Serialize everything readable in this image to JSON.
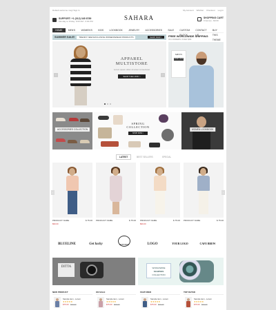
{
  "topbar": {
    "welcome": "Default welcome msg! Sign In",
    "links": [
      "My Account",
      "Wishlist",
      "Checkout",
      "Log In"
    ]
  },
  "header": {
    "support_title": "SUPPORT: +1 (012) 345 6789",
    "support_hours": "Monday to Friday: 9:00 AM - 6:00 PM",
    "logo": "SAHARA",
    "cart_title": "SHOPPING CART",
    "cart_items": "0 item(s) - $0.00"
  },
  "nav": {
    "items": [
      "HOME",
      "MEN'S",
      "WOMEN'S",
      "KIDS",
      "LOOKBOOK",
      "JEWELRY",
      "ACCESSORIES",
      "SALE",
      "CUSTOM BLOCK",
      "CONTACT US",
      "BUY THIS THEME"
    ],
    "active_index": 0
  },
  "promo": {
    "label": "SUMMER SALE!",
    "message": "TRENDY NEW EXCLUSIVE WOMENSWEAR PRODUCTS",
    "button": "SHOP NOW >"
  },
  "hero": {
    "title": "APPAREL MULTISTORE",
    "subtitle": "Lorem ipsum dolor sit amet consectetur",
    "button": "SHOP THE LOOK >",
    "prev": "‹",
    "next": "›",
    "slides": 3,
    "active_slide": 1
  },
  "shipping": {
    "title": "FREE WORLDWIDE SHIPPING",
    "subtitle": "ON ORDERS OVER $99",
    "card_title": "MEN'S",
    "card_button": "SHOP NOW"
  },
  "categories": {
    "left": "ACCESSORIES COLLECTION",
    "center_title": "SPRING COLLECTION",
    "center_button": "SHOP NOW >",
    "right": "WOMEN LOOKBOOK"
  },
  "tabs": {
    "items": [
      "LATEST",
      "BEST SELLERS",
      "SPECIAL"
    ],
    "active_index": 0
  },
  "products": [
    {
      "name": "PRODUCT NAME",
      "price": "$ 75.00",
      "sale": "$99.00"
    },
    {
      "name": "PRODUCT NAME",
      "price": "$ 75.00",
      "sale": ""
    },
    {
      "name": "PRODUCT NAME",
      "price": "$ 75.00",
      "sale": "$99.00"
    },
    {
      "name": "PRODUCT NAME",
      "price": "$ 75.00",
      "sale": ""
    }
  ],
  "product_arrows": {
    "prev": "‹",
    "next": "›"
  },
  "brands": [
    "BLUELINE",
    "Get lucky",
    "NOT FOG",
    "LOGO",
    "YOUR LOGO",
    "CAFE BREW"
  ],
  "banners": {
    "left": "DITTA",
    "right_line1": "WORLDWIDE",
    "right_line2": "SCARVES",
    "right_line3": "COLLECTION"
  },
  "lists": [
    {
      "title": "NEW PRODUCT",
      "name": "Sample item - Lorem",
      "stars": "★★★★★",
      "price": "$75.00",
      "old": "$99.00"
    },
    {
      "title": "ON SALE",
      "name": "Sample item - Lorem",
      "stars": "★★★★★",
      "price": "$75.00",
      "old": "$99.00"
    },
    {
      "title": "FEATURED",
      "name": "Sample item - Lorem",
      "stars": "★★★★★",
      "price": "$75.00",
      "old": "$99.00"
    },
    {
      "title": "TOP RATED",
      "name": "Sample item - Lorem",
      "stars": "★★★★★",
      "price": "$75.00",
      "old": "$99.00"
    }
  ],
  "colors": {
    "promo_bg": "#c3d6da",
    "dark": "#222222",
    "sale_red": "#cc3333",
    "star": "#f0a000"
  }
}
